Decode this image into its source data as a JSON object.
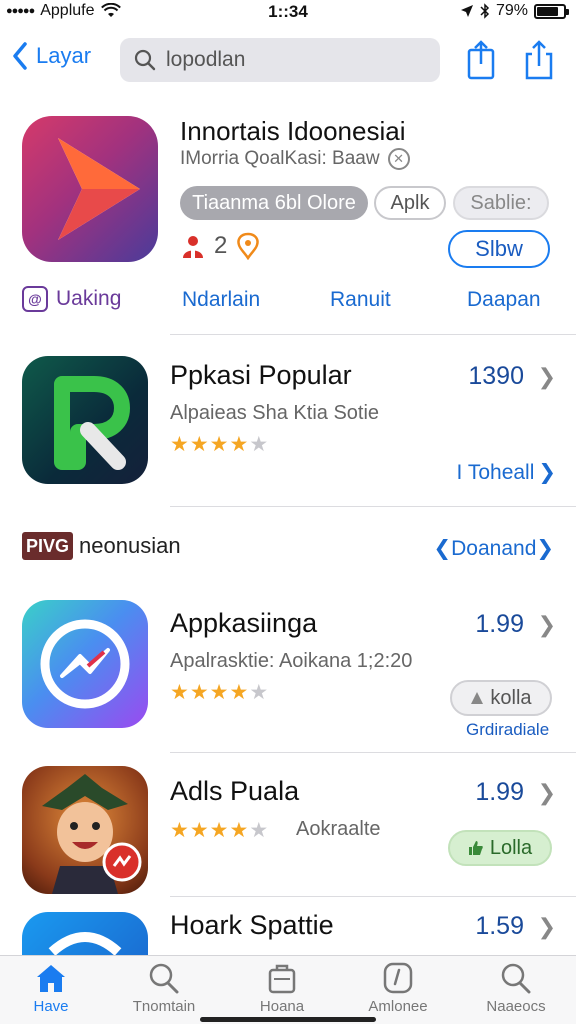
{
  "status_bar": {
    "carrier": "Applufe",
    "time": "1::34",
    "battery": "79%",
    "battery_fraction": 0.79
  },
  "nav": {
    "back_label": "Layar",
    "search_value": "lopodlan",
    "icons": [
      "back-chevron-icon",
      "search-icon",
      "bookmark-share-icon",
      "share-icon"
    ]
  },
  "featured": {
    "title": "Innortais Idoonesiai",
    "subtitle": "IMorria QoalKasi:  Baaw",
    "chips": [
      "Tiaanma 6bl Olore",
      "Aplk",
      "Sablie:"
    ],
    "rating_count": "2",
    "action": "Slbw",
    "tabs": [
      "Uaking",
      "Ndarlain",
      "Ranuit",
      "Daapan"
    ]
  },
  "popular": {
    "title": "Ppkasi Popular",
    "subtitle": "Alpaieas Sha Ktia Sotie",
    "price": "1390",
    "rating": 4,
    "link": "I Toheall"
  },
  "section": {
    "logo_text": "PIVG",
    "title": "neonusian",
    "link": "Doanand"
  },
  "apps": [
    {
      "title": "Appkasiinga",
      "subtitle": "Apalrasktie: Aoikana 1;2:20",
      "price": "1.99",
      "rating": 4,
      "button": "kolla",
      "note": "Grdiradiale"
    },
    {
      "title": "Adls Puala",
      "subtitle": "Aokraalte",
      "price": "1.99",
      "rating": 4,
      "button": "Lolla"
    },
    {
      "title": "Hoark Spattie",
      "price": "1.59"
    }
  ],
  "tab_bar": {
    "items": [
      "Have",
      "Tnomtain",
      "Hoana",
      "Amlonee",
      "Naaeocs"
    ],
    "active_index": 0
  },
  "colors": {
    "accent": "#1a7cf0",
    "star": "#f5a623",
    "price": "#1a4a9a",
    "green_button": "#d6efd0"
  }
}
